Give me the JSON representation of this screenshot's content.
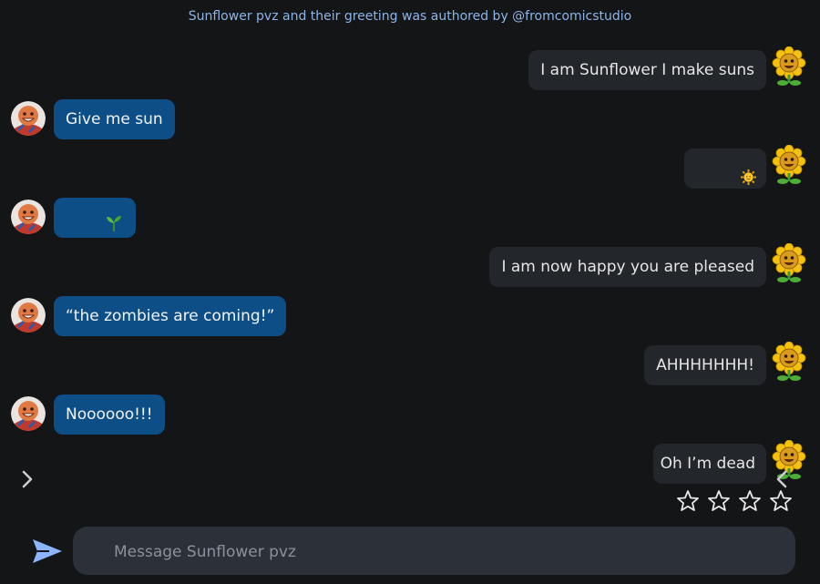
{
  "header": {
    "credit": "Sunflower pvz and their greeting was authored by @fromcomicstudio"
  },
  "messages": [
    {
      "role": "bot",
      "text": "I am Sunflower I make suns"
    },
    {
      "role": "user",
      "text": "Give me sun"
    },
    {
      "role": "bot",
      "text": "",
      "emoji": "sun-emoji"
    },
    {
      "role": "user",
      "text": "",
      "emoji": "seedling-emoji"
    },
    {
      "role": "bot",
      "text": "I am now happy you are pleased"
    },
    {
      "role": "user",
      "text": "“the zombies are coming!”"
    },
    {
      "role": "bot",
      "text": "AHHHHHHH!"
    },
    {
      "role": "user",
      "text": "Noooooo!!!"
    },
    {
      "role": "bot",
      "text": "Oh I’m dead"
    }
  ],
  "rating": {
    "stars_total": 4,
    "stars_filled": 0
  },
  "composer": {
    "placeholder": "Message Sunflower pvz"
  },
  "colors": {
    "background": "#141517",
    "user_bubble": "#0e4e87",
    "bot_bubble": "#23262b",
    "credit_text": "#8db4e8",
    "send_icon": "#8fb4ff"
  }
}
